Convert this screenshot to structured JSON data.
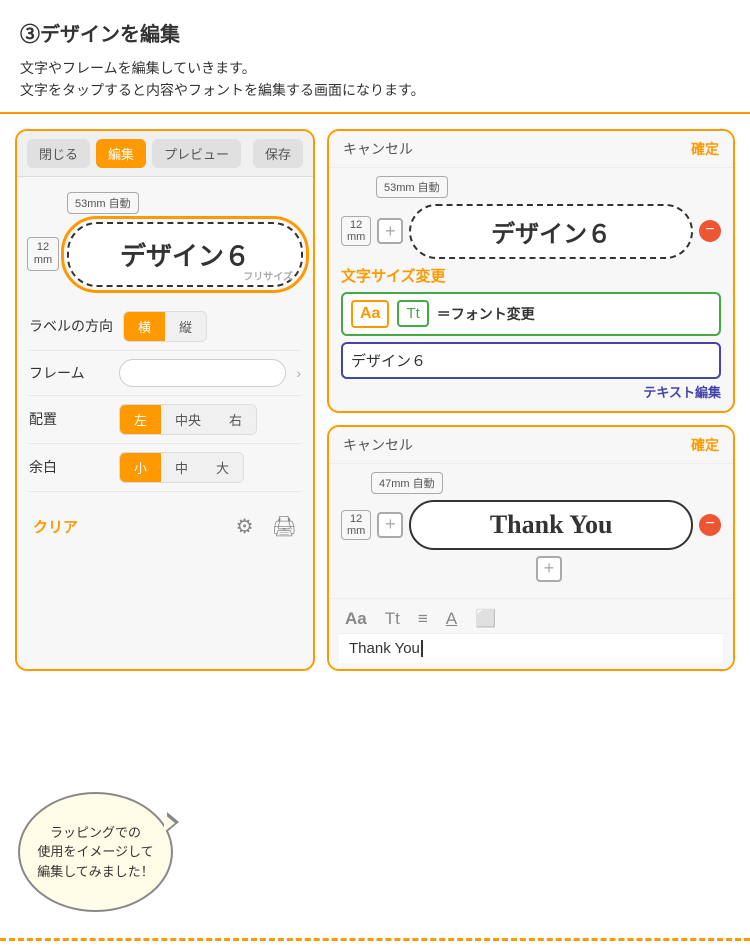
{
  "header": {
    "title": "③デザインを編集",
    "description_line1": "文字やフレームを編集していきます。",
    "description_line2": "文字をタップすると内容やフォントを編集する画面になります。"
  },
  "left_panel": {
    "btn_close": "閉じる",
    "btn_edit": "編集",
    "btn_preview": "プレビュー",
    "btn_save": "保存",
    "size_badge": "53mm 自動",
    "mm_label": "12\nmm",
    "label_text": "デザイン６",
    "resize_label": "フリサイズ",
    "settings": {
      "direction_label": "ラベルの方向",
      "direction_options": [
        "横",
        "縦"
      ],
      "direction_active": "横",
      "frame_label": "フレーム",
      "align_label": "配置",
      "align_options": [
        "左",
        "中央",
        "右"
      ],
      "align_active": "左",
      "margin_label": "余白",
      "margin_options": [
        "小",
        "中",
        "大"
      ],
      "margin_active": "小"
    },
    "clear_btn": "クリア"
  },
  "right_panel1": {
    "btn_cancel": "キャンセル",
    "btn_confirm": "確定",
    "size_badge": "53mm 自動",
    "mm_label": "12\nmm",
    "label_text": "デザイン６",
    "size_change_label": "文字サイズ変更",
    "font_change_label": "＝フォント変更",
    "font_btn_aa": "Aa",
    "font_btn_tt": "Tt",
    "text_input_value": "デザイン６",
    "text_edit_label": "テキスト編集"
  },
  "right_panel2": {
    "btn_cancel": "キャンセル",
    "btn_confirm": "確定",
    "size_badge": "47mm 自動",
    "mm_label": "12\nmm",
    "label_text": "Thank You",
    "text_input_value": "Thank You",
    "icons": {
      "font_size": "Aa",
      "font_style": "Tt",
      "align": "≡",
      "font_color": "A",
      "frame": "⬜"
    }
  },
  "speech_bubble": {
    "text": "ラッピングでの\n使用をイメージして\n編集してみました！"
  }
}
